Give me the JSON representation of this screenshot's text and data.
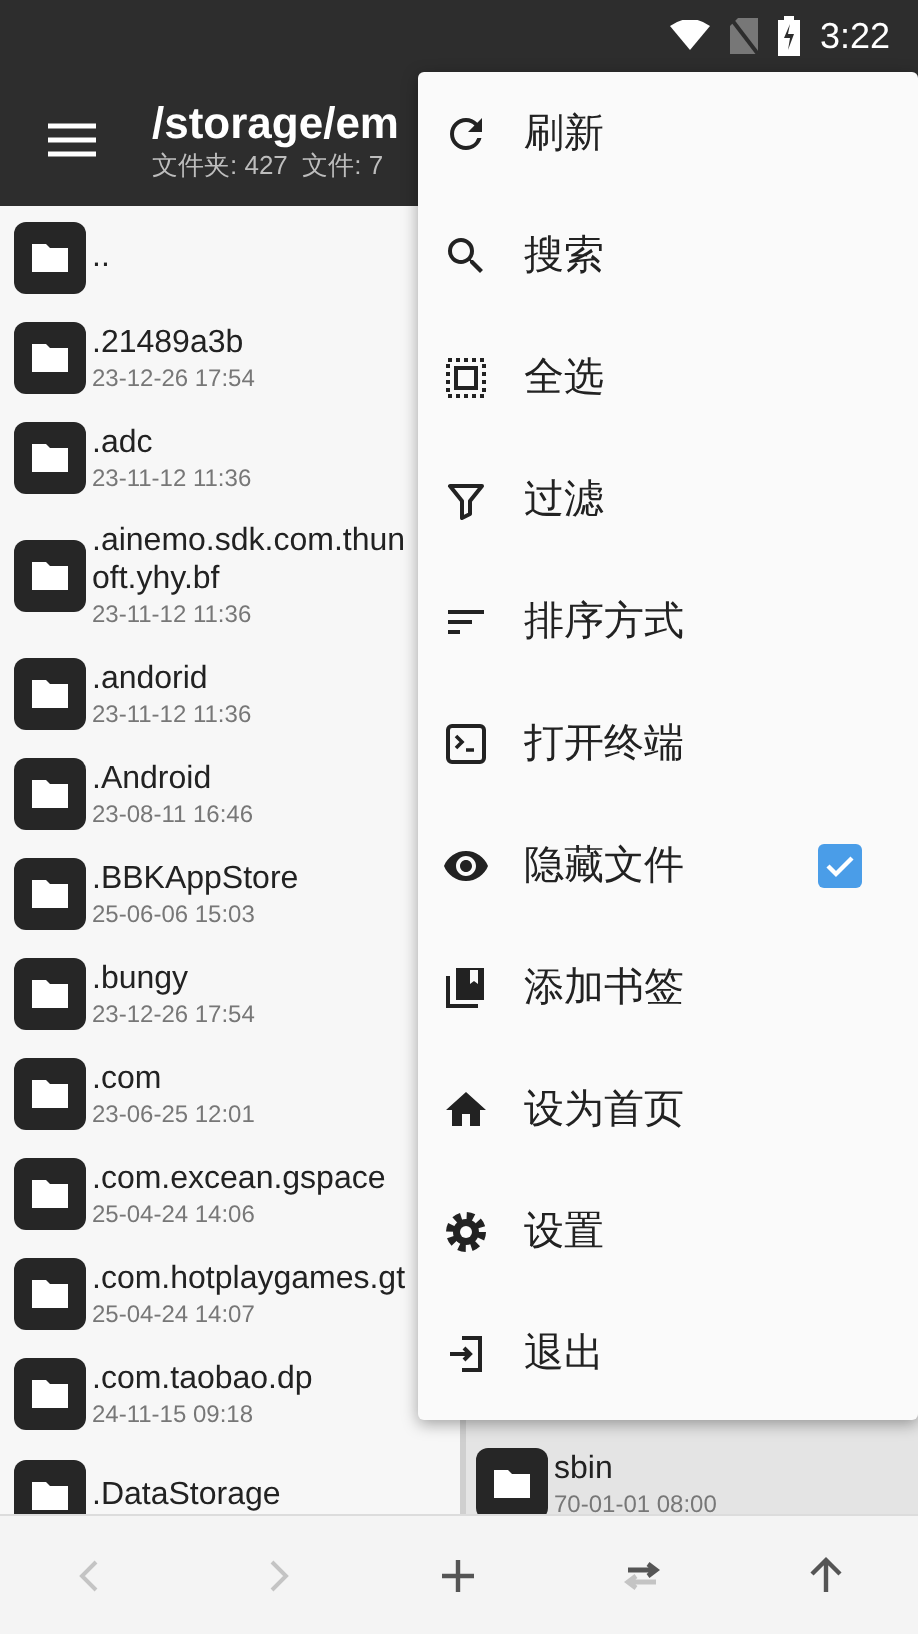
{
  "status_bar": {
    "time": "3:22"
  },
  "app_bar": {
    "title": "/storage/em",
    "subtitle": "文件夹: 427  文件: 7"
  },
  "files": [
    {
      "name": ".."
    },
    {
      "name": ".21489a3b",
      "date": "23-12-26 17:54"
    },
    {
      "name": ".adc",
      "date": "23-11-12 11:36"
    },
    {
      "name": ".ainemo.sdk.com.thun\noft.yhy.bf",
      "date": "23-11-12 11:36"
    },
    {
      "name": ".andorid",
      "date": "23-11-12 11:36"
    },
    {
      "name": ".Android",
      "date": "23-08-11 16:46"
    },
    {
      "name": ".BBKAppStore",
      "date": "25-06-06 15:03"
    },
    {
      "name": ".bungy",
      "date": "23-12-26 17:54"
    },
    {
      "name": ".com",
      "date": "23-06-25 12:01"
    },
    {
      "name": ".com.excean.gspace",
      "date": "25-04-24 14:06"
    },
    {
      "name": ".com.hotplaygames.gt",
      "date": "25-04-24 14:07"
    },
    {
      "name": ".com.taobao.dp",
      "date": "24-11-15 09:18"
    },
    {
      "name": ".DataStorage"
    }
  ],
  "second_pane": {
    "files": [
      {
        "name": "sbin",
        "date": "70-01-01 08:00"
      }
    ]
  },
  "menu": [
    {
      "kind": "action",
      "label": "刷新"
    },
    {
      "kind": "action",
      "label": "搜索"
    },
    {
      "kind": "action",
      "label": "全选"
    },
    {
      "kind": "action",
      "label": "过滤"
    },
    {
      "kind": "action",
      "label": "排序方式"
    },
    {
      "kind": "action",
      "label": "打开终端"
    },
    {
      "kind": "checkbox",
      "label": "隐藏文件",
      "checked": true
    },
    {
      "kind": "action",
      "label": "添加书签"
    },
    {
      "kind": "action",
      "label": "设为首页"
    },
    {
      "kind": "action",
      "label": "设置"
    },
    {
      "kind": "action",
      "label": "退出"
    }
  ],
  "toolbar": [
    {
      "disabled": true
    },
    {
      "disabled": true
    },
    {
      "disabled": false
    },
    {
      "disabled": false
    },
    {
      "disabled": false
    }
  ]
}
